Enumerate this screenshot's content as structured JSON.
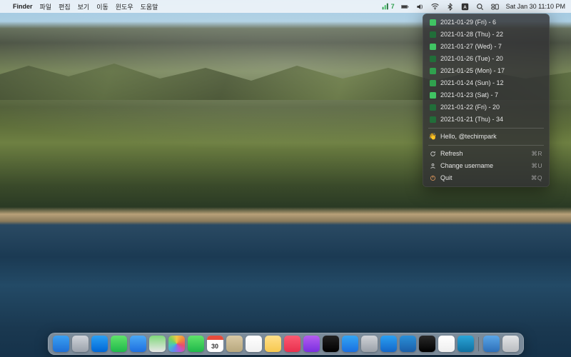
{
  "menubar": {
    "apple": "",
    "app_name": "Finder",
    "items": [
      "파일",
      "편집",
      "보기",
      "이동",
      "윈도우",
      "도움말"
    ],
    "status_app": {
      "count": "7"
    },
    "clock": "Sat Jan 30  11:10 PM"
  },
  "panel": {
    "contributions": [
      {
        "date": "2021-01-29 (Fri)",
        "count": "6",
        "level": 2
      },
      {
        "date": "2021-01-28 (Thu)",
        "count": "22",
        "level": 4
      },
      {
        "date": "2021-01-27 (Wed)",
        "count": "7",
        "level": 2
      },
      {
        "date": "2021-01-26 (Tue)",
        "count": "20",
        "level": 4
      },
      {
        "date": "2021-01-25 (Mon)",
        "count": "17",
        "level": 3
      },
      {
        "date": "2021-01-24 (Sun)",
        "count": "12",
        "level": 3
      },
      {
        "date": "2021-01-23 (Sat)",
        "count": "7",
        "level": 2
      },
      {
        "date": "2021-01-22 (Fri)",
        "count": "20",
        "level": 4
      },
      {
        "date": "2021-01-21 (Thu)",
        "count": "34",
        "level": 4
      }
    ],
    "hello_label": "Hello,",
    "username": "@techimpark",
    "actions": {
      "refresh": {
        "label": "Refresh",
        "shortcut": "⌘R"
      },
      "change": {
        "label": "Change username",
        "shortcut": "⌘U"
      },
      "quit": {
        "label": "Quit",
        "shortcut": "⌘Q"
      }
    }
  },
  "colors": {
    "lawn": [
      "#ebedf0",
      "#9be9a8",
      "#40c463",
      "#30a14e",
      "#216e39"
    ]
  },
  "dock": [
    {
      "name": "finder",
      "bg": "linear-gradient(#3aa0f2,#1e6fd6)"
    },
    {
      "name": "launchpad",
      "bg": "linear-gradient(#d0d4da,#9aa1ab)"
    },
    {
      "name": "safari",
      "bg": "linear-gradient(#2aa0f4,#0066d6)"
    },
    {
      "name": "messages",
      "bg": "linear-gradient(#5fe36a,#1fb84a)"
    },
    {
      "name": "mail",
      "bg": "linear-gradient(#4aa8f5,#1d6fe0)"
    },
    {
      "name": "maps",
      "bg": "linear-gradient(#7fd77a,#e7e7e7)"
    },
    {
      "name": "photos",
      "bg": "conic-gradient(#f6c544,#f08b3c,#e94f6a,#b755d6,#5a8df0,#48c8b8,#7ad35a,#f6c544)"
    },
    {
      "name": "facetime",
      "bg": "linear-gradient(#5fe36a,#1fb84a)"
    },
    {
      "name": "calendar",
      "bg": "linear-gradient(#fff 35%,#fff 35%)",
      "extra": "cal"
    },
    {
      "name": "contacts",
      "bg": "linear-gradient(#d9c9a5,#b8a87e)"
    },
    {
      "name": "reminders",
      "bg": "linear-gradient(#fff,#f0f0f0)"
    },
    {
      "name": "notes",
      "bg": "linear-gradient(#ffe08a,#f7c94f)"
    },
    {
      "name": "music",
      "bg": "linear-gradient(#fb5a72,#e9304e)"
    },
    {
      "name": "podcasts",
      "bg": "linear-gradient(#b45df0,#7a2fe0)"
    },
    {
      "name": "tv",
      "bg": "linear-gradient(#222,#000)"
    },
    {
      "name": "appstore",
      "bg": "linear-gradient(#34a6f4,#1a6fe0)"
    },
    {
      "name": "settings",
      "bg": "linear-gradient(#d0d3d8,#9aa0a8)"
    },
    {
      "name": "xcode",
      "bg": "linear-gradient(#2aa0f2,#1466c8)"
    },
    {
      "name": "vscode",
      "bg": "linear-gradient(#2a8fd8,#1b5fa8)"
    },
    {
      "name": "iterm",
      "bg": "linear-gradient(#2a2a2a,#000)"
    },
    {
      "name": "notion",
      "bg": "linear-gradient(#fff,#eee)"
    },
    {
      "name": "anki",
      "bg": "linear-gradient(#2aa5d8,#0f6fa0)"
    },
    {
      "name": "__sep__"
    },
    {
      "name": "downloads",
      "bg": "linear-gradient(#5aa6e8,#2d6fb8)"
    },
    {
      "name": "trash",
      "bg": "linear-gradient(#e2e4e6,#b9bcc0)"
    }
  ]
}
